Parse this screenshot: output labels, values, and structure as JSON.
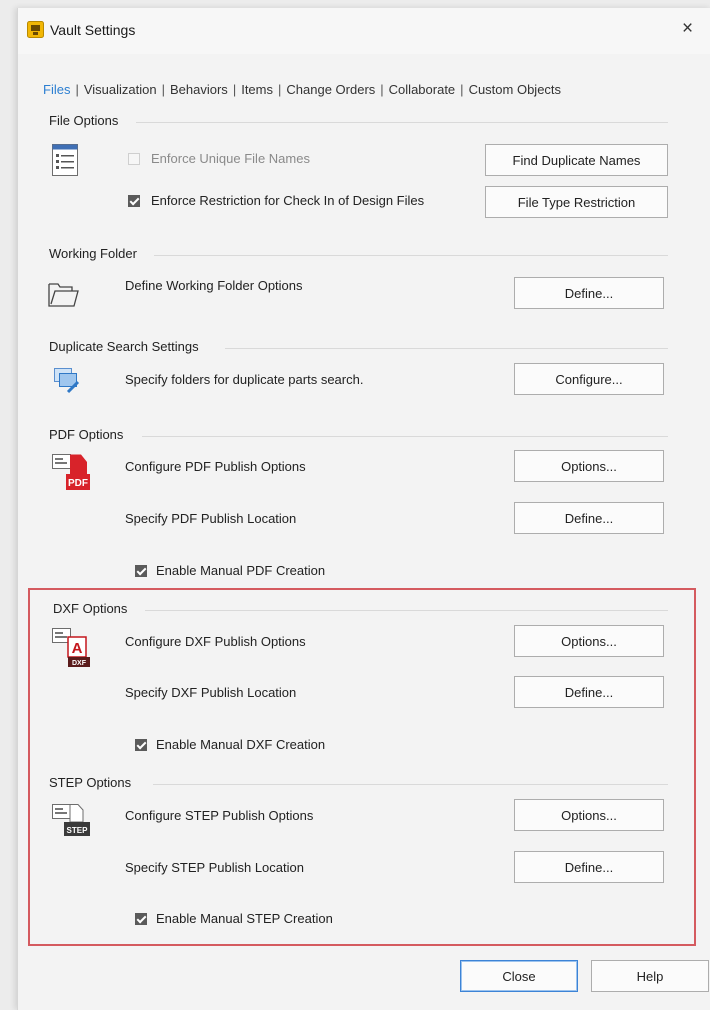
{
  "window": {
    "title": "Vault Settings",
    "close_glyph": "×"
  },
  "tabs": [
    {
      "label": "Files",
      "active": true
    },
    {
      "label": "Visualization"
    },
    {
      "label": "Behaviors"
    },
    {
      "label": "Items"
    },
    {
      "label": "Change Orders"
    },
    {
      "label": "Collaborate"
    },
    {
      "label": "Custom Objects"
    }
  ],
  "tab_separator": "|",
  "file_options": {
    "heading": "File Options",
    "unique_names": {
      "label": "Enforce Unique File Names",
      "checked": false,
      "enabled": false
    },
    "restriction": {
      "label": "Enforce Restriction for Check In of Design Files",
      "checked": true
    },
    "find_duplicates_button": "Find Duplicate Names",
    "file_type_button": "File Type Restriction"
  },
  "working_folder": {
    "heading": "Working Folder",
    "label": "Define Working Folder Options",
    "button": "Define..."
  },
  "duplicate_search": {
    "heading": "Duplicate Search Settings",
    "label": "Specify folders for duplicate parts search.",
    "button": "Configure..."
  },
  "pdf_options": {
    "heading": "PDF Options",
    "icon_text": "PDF",
    "configure_label": "Configure PDF Publish Options",
    "configure_button": "Options...",
    "location_label": "Specify PDF Publish Location",
    "location_button": "Define...",
    "manual": {
      "label": "Enable Manual PDF Creation",
      "checked": true
    }
  },
  "dxf_options": {
    "heading": "DXF Options",
    "icon_text": "DXF",
    "icon_letter": "A",
    "configure_label": "Configure DXF Publish Options",
    "configure_button": "Options...",
    "location_label": "Specify DXF Publish Location",
    "location_button": "Define...",
    "manual": {
      "label": "Enable Manual DXF Creation",
      "checked": true
    }
  },
  "step_options": {
    "heading": "STEP Options",
    "icon_text": "STEP",
    "configure_label": "Configure STEP Publish Options",
    "configure_button": "Options...",
    "location_label": "Specify STEP Publish Location",
    "location_button": "Define...",
    "manual": {
      "label": "Enable Manual STEP Creation",
      "checked": true
    }
  },
  "footer": {
    "close_button": "Close",
    "help_button": "Help"
  },
  "colors": {
    "active_tab": "#2c7fd1",
    "highlight_border": "#d45a5f",
    "pdf_red": "#d8232a",
    "dark_badge": "#3a3a3a"
  }
}
